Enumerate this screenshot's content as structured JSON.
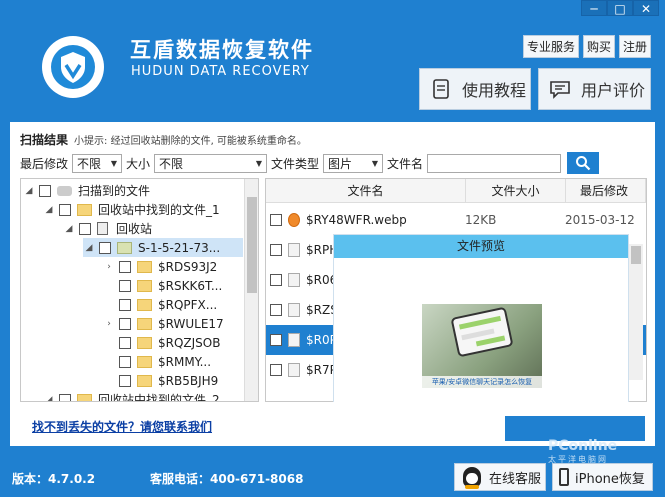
{
  "window": {
    "minimize": "─",
    "maximize": "□",
    "close": "✕"
  },
  "brand": {
    "title": "互盾数据恢复软件",
    "subtitle": "HUDUN DATA RECOVERY"
  },
  "top_links": [
    "专业服务",
    "购买",
    "注册"
  ],
  "big_buttons": {
    "tutorial": "使用教程",
    "review": "用户评价"
  },
  "scan": {
    "label": "扫描结果",
    "tip": "小提示: 经过回收站删除的文件, 可能被系统重命名。"
  },
  "filters": {
    "modified_label": "最后修改",
    "modified_value": "不限",
    "size_label": "大小",
    "size_value": "不限",
    "type_label": "文件类型",
    "type_value": "图片",
    "name_label": "文件名",
    "name_value": ""
  },
  "tree": [
    {
      "label": "扫描到的文件"
    },
    {
      "label": "回收站中找到的文件_1"
    },
    {
      "label": "回收站"
    },
    {
      "label": "S-1-5-21-73..."
    },
    {
      "label": "$RDS93J2"
    },
    {
      "label": "$RSKK6T..."
    },
    {
      "label": "$RQPFX..."
    },
    {
      "label": "$RWULE17"
    },
    {
      "label": "$RQZJSOB"
    },
    {
      "label": "$RMMY..."
    },
    {
      "label": "$RB5BJH9"
    },
    {
      "label": "回收站中找到的文件_2"
    }
  ],
  "list": {
    "columns": [
      "文件名",
      "文件大小",
      "最后修改"
    ],
    "rows": [
      {
        "name": "$RY48WFR.webp",
        "size": "12KB",
        "date": "2015-03-12"
      },
      {
        "name": "$RPH",
        "size": "",
        "date": ""
      },
      {
        "name": "$R06",
        "size": "",
        "date": ""
      },
      {
        "name": "$RZS",
        "size": "",
        "date": ""
      },
      {
        "name": "$R0P",
        "size": "",
        "date": ""
      },
      {
        "name": "$R7P",
        "size": "",
        "date": ""
      }
    ]
  },
  "preview": {
    "title": "文件预览",
    "caption": "苹果/安卓微信聊天记录怎么恢复"
  },
  "help_link": "找不到丢失的文件？请您联系我们",
  "footer": {
    "version": "版本：4.7.0.2",
    "phone": "客服电话：400-671-8068",
    "online": "在线客服",
    "iphone": "iPhone恢复"
  },
  "watermark": {
    "main": "PConline",
    "sub": "太平洋电脑网"
  },
  "colors": {
    "primary": "#1f80d0",
    "preview_header": "#5bc0ee"
  }
}
